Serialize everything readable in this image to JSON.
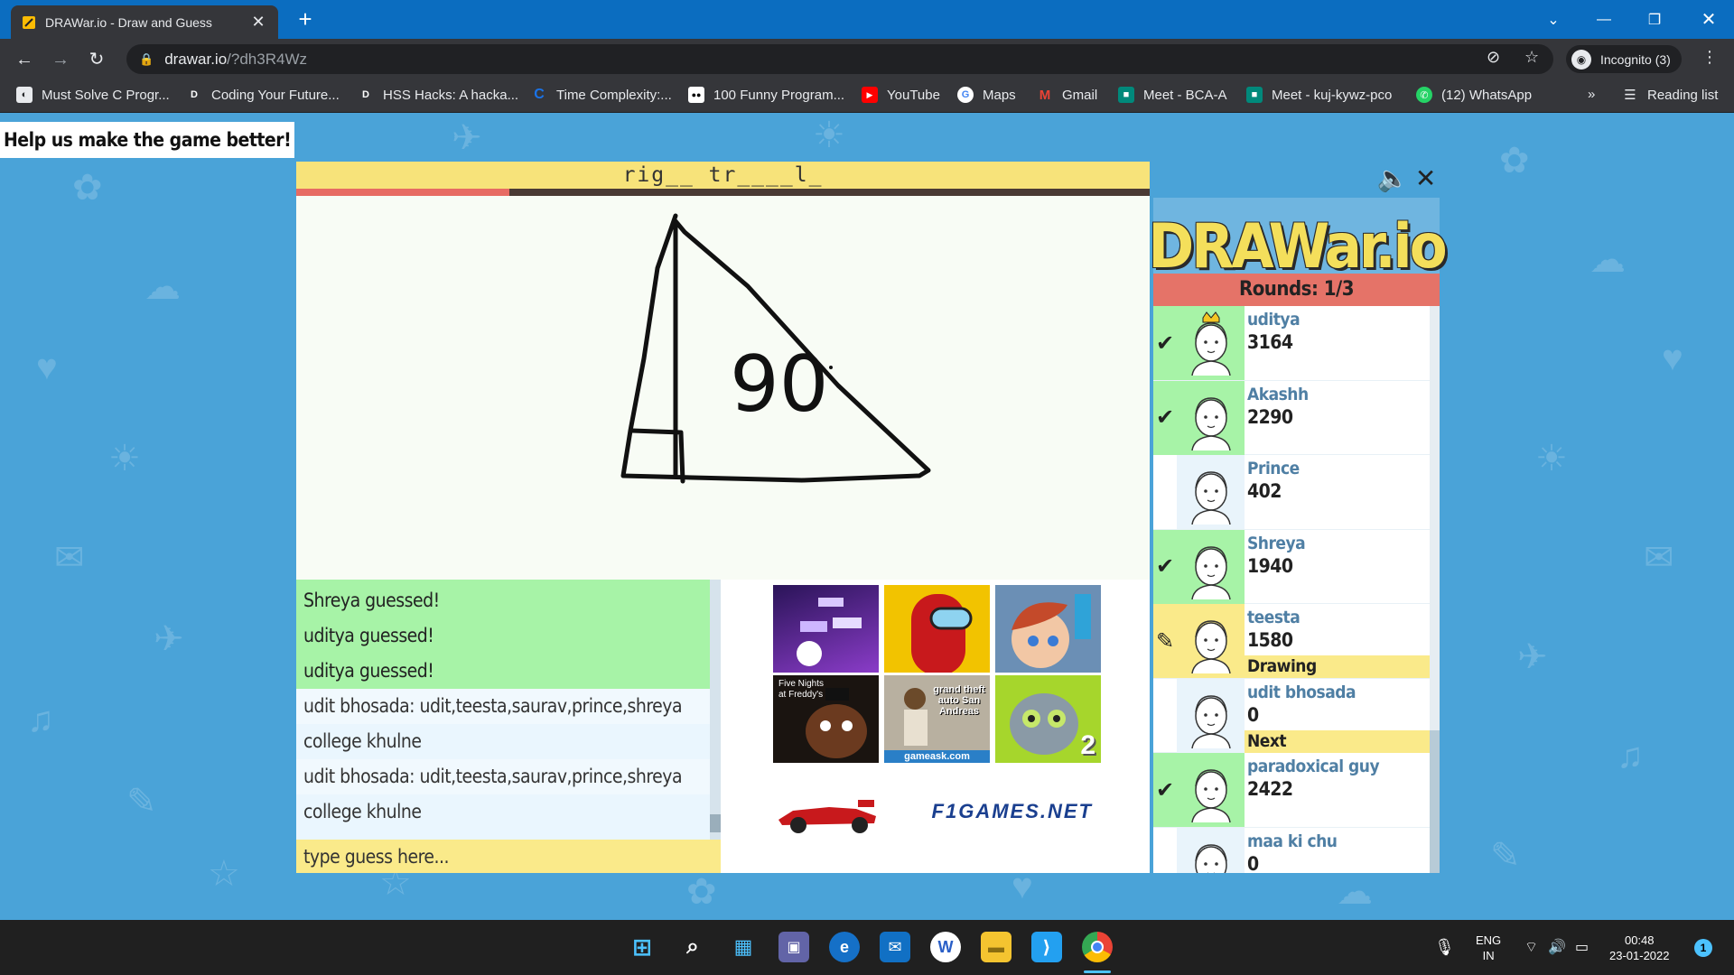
{
  "browser": {
    "tab": {
      "title": "DRAWar.io - Draw and Guess"
    },
    "url": {
      "host": "drawar.io",
      "path": "/?dh3R4Wz"
    },
    "incognito_label": "Incognito (3)",
    "bookmarks": [
      {
        "label": "Must Solve C Progr...",
        "icon_color": "#3c4043"
      },
      {
        "label": "Coding Your Future...",
        "icon_color": "#35363a"
      },
      {
        "label": "HSS Hacks: A hacka...",
        "icon_color": "#35363a"
      },
      {
        "label": "Time Complexity:...",
        "icon_color": "#1a73e8"
      },
      {
        "label": "100 Funny Program...",
        "icon_color": "#000000"
      },
      {
        "label": "YouTube",
        "icon_color": "#ff0000"
      },
      {
        "label": "Maps",
        "icon_color": "#ffffff"
      },
      {
        "label": "Gmail",
        "icon_color": "#ffffff"
      },
      {
        "label": "Meet - BCA-A",
        "icon_color": "#00897b"
      },
      {
        "label": "Meet - kuj-kywz-pco",
        "icon_color": "#00897b"
      },
      {
        "label": "(12) WhatsApp",
        "icon_color": "#25d366"
      }
    ],
    "more_label": "»",
    "reading_list": "Reading list"
  },
  "game": {
    "help_banner": "Help us make the game better!",
    "word_hint": "rig__ tr____l_",
    "timer_fraction": 0.25,
    "canvas_text": "90",
    "chat": [
      {
        "text": "Shreya guessed!",
        "type": "guessed"
      },
      {
        "text": "uditya guessed!",
        "type": "guessed"
      },
      {
        "text": "uditya guessed!",
        "type": "guessed"
      },
      {
        "text": "udit bhosada: udit,teesta,saurav,prince,shreya",
        "type": "alt"
      },
      {
        "text": "college khulne",
        "type": "plain"
      },
      {
        "text": "udit bhosada: udit,teesta,saurav,prince,shreya",
        "type": "alt"
      },
      {
        "text": "college khulne",
        "type": "plain"
      }
    ],
    "guess_placeholder": "type guess here...",
    "ads": {
      "fnaf_text": "Five Nights at Freddy's",
      "gta_text": "grand theft auto San Andreas",
      "gta_sub": "gameask.com",
      "tom_badge": "2",
      "f1_text": "F1GAMES.NET"
    },
    "logo": "DRAWar.io",
    "rounds": "Rounds: 1/3",
    "players": [
      {
        "name": "uditya",
        "score": "3164",
        "status": "guessed",
        "crown": true,
        "role": ""
      },
      {
        "name": "Akashh",
        "score": "2290",
        "status": "guessed",
        "crown": false,
        "role": ""
      },
      {
        "name": "Prince",
        "score": "402",
        "status": "none",
        "crown": false,
        "role": ""
      },
      {
        "name": "Shreya",
        "score": "1940",
        "status": "guessed",
        "crown": false,
        "role": ""
      },
      {
        "name": "teesta",
        "score": "1580",
        "status": "drawing",
        "crown": false,
        "role": "Drawing"
      },
      {
        "name": "udit bhosada",
        "score": "0",
        "status": "none",
        "crown": false,
        "role": "Next"
      },
      {
        "name": "paradoxical guy",
        "score": "2422",
        "status": "guessed",
        "crown": false,
        "role": ""
      },
      {
        "name": "maa ki chu",
        "score": "0",
        "status": "none",
        "crown": false,
        "role": ""
      }
    ]
  },
  "taskbar": {
    "lang_top": "ENG",
    "lang_bottom": "IN",
    "time": "00:48",
    "date": "23-01-2022",
    "notification_count": "1"
  }
}
